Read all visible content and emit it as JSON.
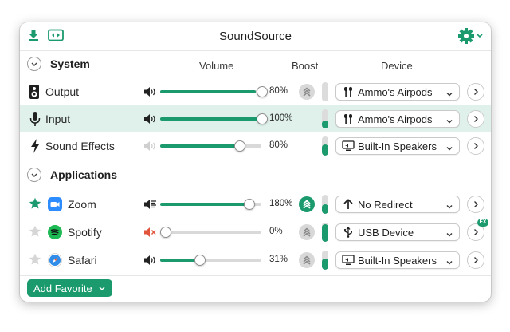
{
  "window": {
    "title": "SoundSource"
  },
  "toolbar": {
    "left_icons": [
      "download-icon",
      "screen-capture-icon"
    ],
    "right_icon": "gear-icon"
  },
  "columns": {
    "volume": "Volume",
    "boost": "Boost",
    "device": "Device"
  },
  "system": {
    "title": "System",
    "rows": [
      {
        "label": "Output",
        "icon": "speaker-icon",
        "volume_pct": "80%",
        "volume": 0.8,
        "boost": "off",
        "meter": 0.0,
        "device": "Ammo's Airpods",
        "device_icon": "airpods-icon"
      },
      {
        "label": "Input",
        "icon": "microphone-icon",
        "volume_pct": "100%",
        "volume": 1.0,
        "boost": "none",
        "meter": 0.6,
        "device": "Ammo's Airpods",
        "device_icon": "airpods-icon"
      },
      {
        "label": "Sound Effects",
        "icon": "lightning-icon",
        "volume_pct": "80%",
        "volume": 0.8,
        "boost": "none",
        "meter": 0.6,
        "device": "Built-In Speakers",
        "device_icon": "display-speaker-icon"
      }
    ]
  },
  "applications": {
    "title": "Applications",
    "rows": [
      {
        "label": "Zoom",
        "icon": "zoom-icon",
        "favorite": true,
        "volume_pct": "180%",
        "volume": 0.9,
        "boost": "on",
        "meter": 0.5,
        "device": "No Redirect",
        "device_icon": "arrow-up-icon"
      },
      {
        "label": "Spotify",
        "icon": "spotify-icon",
        "favorite": false,
        "volume_pct": "0%",
        "volume": 0.0,
        "boost": "off",
        "meter": 0.9,
        "device": "USB Device",
        "device_icon": "usb-icon",
        "fx": "FX"
      },
      {
        "label": "Safari",
        "icon": "safari-icon",
        "favorite": false,
        "volume_pct": "31%",
        "volume": 0.31,
        "boost": "off",
        "meter": 0.6,
        "device": "Built-In Speakers",
        "device_icon": "display-speaker-icon"
      }
    ]
  },
  "footer": {
    "add_favorite": "Add Favorite"
  },
  "colors": {
    "accent": "#1b9a6e",
    "selected_row": "#dff1ea",
    "muted_red": "#e0553b"
  }
}
